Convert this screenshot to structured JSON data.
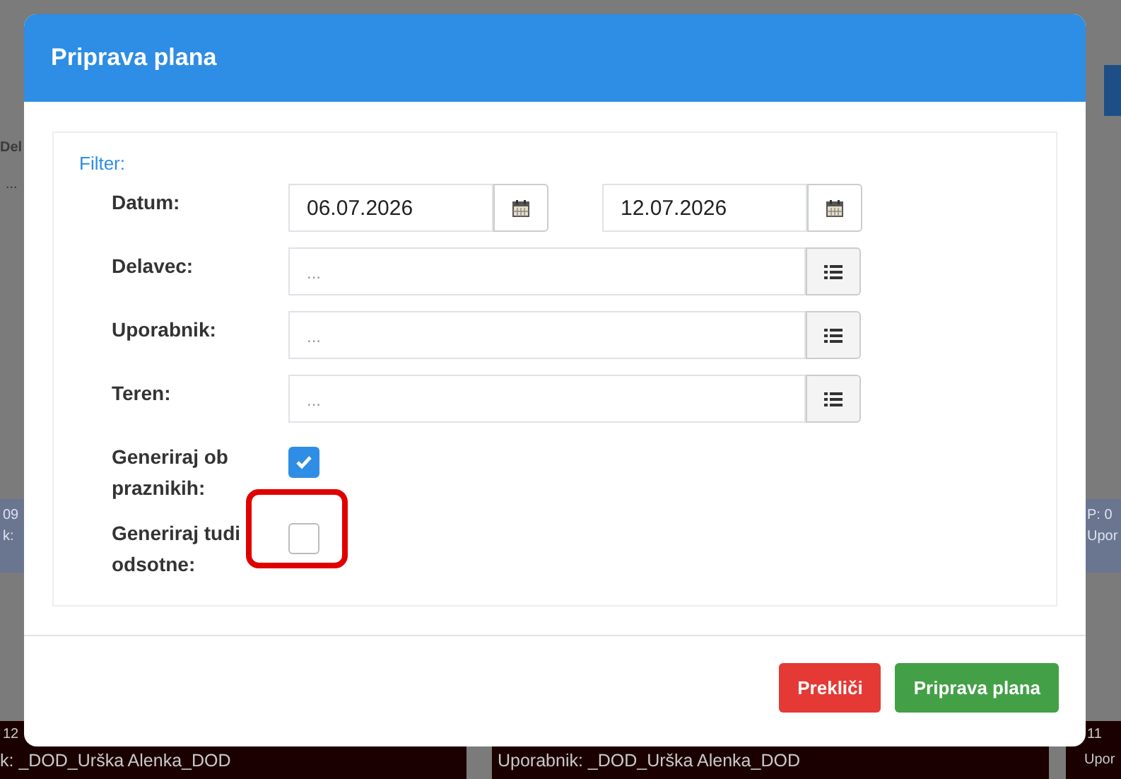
{
  "background": {
    "column_heading": "Del",
    "placeholder": "...",
    "events": [
      {
        "time": "09",
        "user": "k:"
      },
      {
        "time": "P: 0",
        "user": "Upor"
      }
    ],
    "bottom_events": [
      {
        "time": "12",
        "user": "k: _DOD_Urška Alenka_DOD"
      },
      {
        "user": "Uporabnik: _DOD_Urška Alenka_DOD"
      },
      {
        "time": "11",
        "user": "Upor"
      }
    ]
  },
  "dialog": {
    "title": "Priprava plana",
    "filter_label": "Filter:",
    "fields": [
      {
        "label": "Datum:",
        "kind": "date_range",
        "values": [
          "06.07.2026",
          "12.07.2026"
        ]
      },
      {
        "label": "Delavec:",
        "kind": "picker",
        "placeholder": "..."
      },
      {
        "label": "Uporabnik:",
        "kind": "picker",
        "placeholder": "..."
      },
      {
        "label": "Teren:",
        "kind": "picker",
        "placeholder": "..."
      }
    ],
    "checkboxes": [
      {
        "label": "Generiraj ob praznikih:",
        "checked": true,
        "highlighted": false
      },
      {
        "label": "Generiraj tudi odsotne:",
        "checked": false,
        "highlighted": true
      }
    ],
    "buttons": [
      {
        "label": "Prekliči",
        "kind": "danger"
      },
      {
        "label": "Priprava plana",
        "kind": "primary"
      }
    ]
  }
}
